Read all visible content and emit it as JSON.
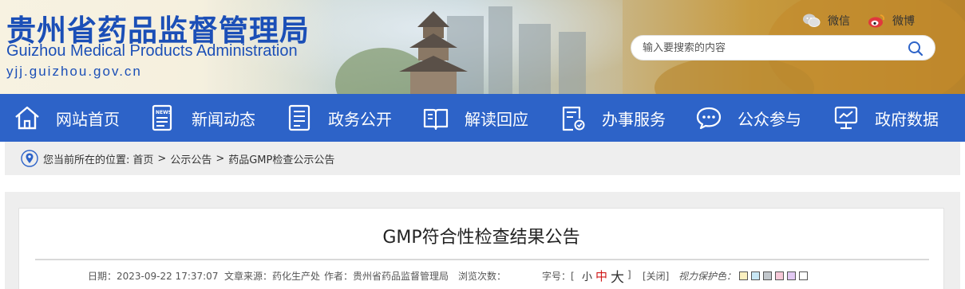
{
  "header": {
    "title_cn": "贵州省药品监督管理局",
    "title_en": "Guizhou Medical Products Administration",
    "url": "yjj.guizhou.gov.cn",
    "wechat_label": "微信",
    "weibo_label": "微博",
    "search_placeholder": "输入要搜索的内容",
    "icons": {
      "wechat": "wechat-icon",
      "weibo": "weibo-icon",
      "search": "search-icon"
    }
  },
  "nav": {
    "items": [
      {
        "label": "网站首页",
        "icon": "home-icon"
      },
      {
        "label": "新闻动态",
        "icon": "news-icon"
      },
      {
        "label": "政务公开",
        "icon": "document-list-icon"
      },
      {
        "label": "解读回应",
        "icon": "open-book-icon"
      },
      {
        "label": "办事服务",
        "icon": "service-form-icon"
      },
      {
        "label": "公众参与",
        "icon": "chat-bubble-icon"
      },
      {
        "label": "政府数据",
        "icon": "data-monitor-icon"
      }
    ],
    "color": "#2d63c8"
  },
  "breadcrumb": {
    "prefix": "您当前所在的位置:",
    "items": [
      "首页",
      "公示公告",
      "药品GMP检查公示公告"
    ],
    "separator": ">",
    "icon": "location-pin-icon"
  },
  "article": {
    "title": "GMP符合性检查结果公告",
    "date": "日期：2023-09-22 17:37:07",
    "source": "文章来源：药化生产处",
    "author": "作者：贵州省药品监督管理局",
    "views": "浏览次数：",
    "font_size_label": "字号：[",
    "font_small": "小",
    "font_medium": "中",
    "font_large": "大",
    "font_close_bracket": "]",
    "close": "[关闭]",
    "eye_care_label": "视力保护色：",
    "eye_care_colors": [
      "#fbf0c0",
      "#c8e7f5",
      "#c2c7cc",
      "#f7c9d8",
      "#e2c9f3",
      "#ffffff"
    ]
  }
}
